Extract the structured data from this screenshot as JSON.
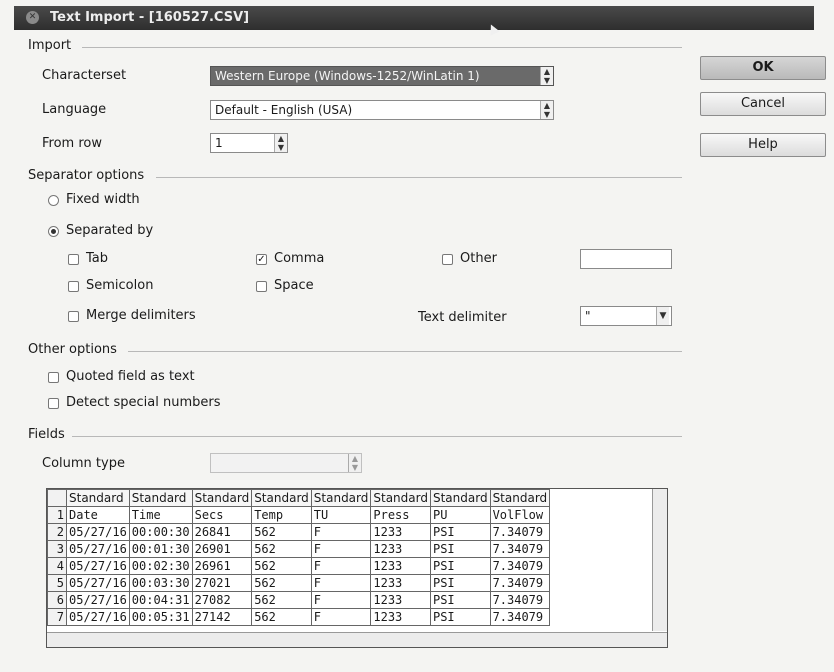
{
  "window": {
    "title": "Text Import - [160527.CSV]"
  },
  "buttons": {
    "ok": "OK",
    "cancel": "Cancel",
    "help": "Help"
  },
  "import": {
    "section_label": "Import",
    "characterset_label": "Characterset",
    "characterset_value": "Western Europe (Windows-1252/WinLatin 1)",
    "language_label": "Language",
    "language_value": "Default - English (USA)",
    "from_row_label": "From row",
    "from_row_value": "1"
  },
  "separator": {
    "section_label": "Separator options",
    "fixed_width_label": "Fixed width",
    "separated_by_label": "Separated by",
    "separated_by_selected": true,
    "tab_label": "Tab",
    "comma_label": "Comma",
    "comma_checked": true,
    "other_label": "Other",
    "other_value": "",
    "semicolon_label": "Semicolon",
    "space_label": "Space",
    "merge_label": "Merge delimiters",
    "text_delimiter_label": "Text delimiter",
    "text_delimiter_value": "\""
  },
  "other_options": {
    "section_label": "Other options",
    "quoted_label": "Quoted field as text",
    "detect_label": "Detect special numbers"
  },
  "fields": {
    "section_label": "Fields",
    "column_type_label": "Column type",
    "column_type_value": "",
    "headers": [
      "Standard",
      "Standard",
      "Standard",
      "Standard",
      "Standard",
      "Standard",
      "Standard",
      "Standard"
    ],
    "rows": [
      {
        "n": "1",
        "cells": [
          "Date",
          "Time",
          "Secs",
          "Temp",
          "TU",
          "Press",
          "PU",
          "VolFlow"
        ]
      },
      {
        "n": "2",
        "cells": [
          "05/27/16",
          "00:00:30",
          "26841",
          "562",
          "F",
          "1233",
          "PSI",
          "7.34079"
        ]
      },
      {
        "n": "3",
        "cells": [
          "05/27/16",
          "00:01:30",
          "26901",
          "562",
          "F",
          "1233",
          "PSI",
          "7.34079"
        ]
      },
      {
        "n": "4",
        "cells": [
          "05/27/16",
          "00:02:30",
          "26961",
          "562",
          "F",
          "1233",
          "PSI",
          "7.34079"
        ]
      },
      {
        "n": "5",
        "cells": [
          "05/27/16",
          "00:03:30",
          "27021",
          "562",
          "F",
          "1233",
          "PSI",
          "7.34079"
        ]
      },
      {
        "n": "6",
        "cells": [
          "05/27/16",
          "00:04:31",
          "27082",
          "562",
          "F",
          "1233",
          "PSI",
          "7.34079"
        ]
      },
      {
        "n": "7",
        "cells": [
          "05/27/16",
          "00:05:31",
          "27142",
          "562",
          "F",
          "1233",
          "PSI",
          "7.34079"
        ]
      }
    ]
  }
}
